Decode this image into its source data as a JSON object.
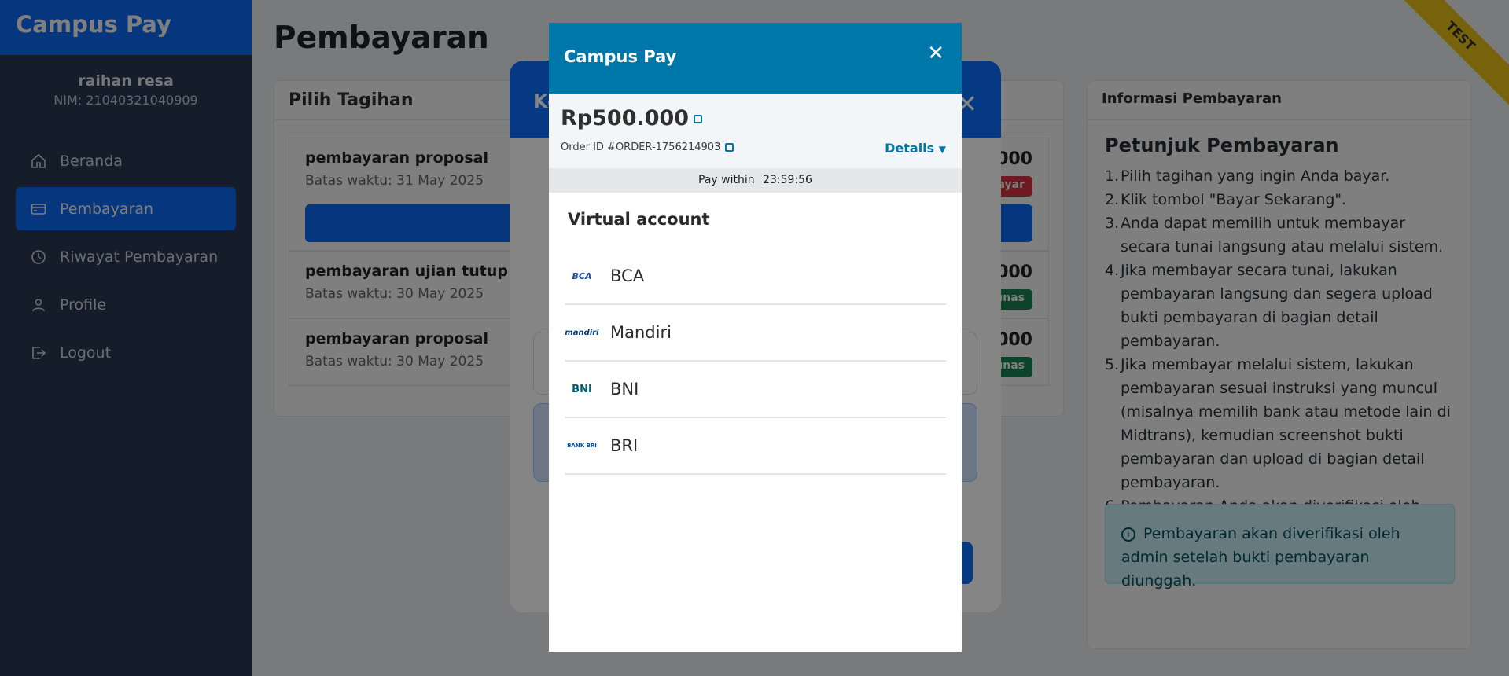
{
  "app": {
    "brand": "Campus Pay"
  },
  "user": {
    "name": "raihan resa",
    "nim": "NIM: 21040321040909"
  },
  "nav": [
    {
      "label": "Beranda",
      "icon": "home-icon",
      "active": false
    },
    {
      "label": "Pembayaran",
      "icon": "card-icon",
      "active": true
    },
    {
      "label": "Riwayat Pembayaran",
      "icon": "clock-icon",
      "active": false
    },
    {
      "label": "Profile",
      "icon": "user-icon",
      "active": false
    },
    {
      "label": "Logout",
      "icon": "logout-icon",
      "active": false
    }
  ],
  "page": {
    "title": "Pembayaran"
  },
  "bills_card": {
    "title": "Pilih Tagihan",
    "bills": [
      {
        "title": "pembayaran proposal",
        "deadline": "Batas waktu: 31 May 2025",
        "amount": "000",
        "status": "ayar",
        "status_color": "#dc3545"
      },
      {
        "title": "pembayaran ujian tutup",
        "deadline": "Batas waktu: 30 May 2025",
        "amount": "000",
        "status": "unas",
        "status_color": "#198754"
      },
      {
        "title": "pembayaran proposal",
        "deadline": "Batas waktu: 30 May 2025",
        "amount": "000",
        "status": "unas",
        "status_color": "#198754"
      }
    ]
  },
  "info_card": {
    "title": "Informasi Pembayaran",
    "guide_title": "Petunjuk Pembayaran",
    "steps": [
      "Pilih tagihan yang ingin Anda bayar.",
      "Klik tombol \"Bayar Sekarang\".",
      "Anda dapat memilih untuk membayar secara tunai langsung atau melalui sistem.",
      "Jika membayar secara tunai, lakukan pembayaran langsung dan segera upload bukti pembayaran di bagian detail pembayaran.",
      "Jika membayar melalui sistem, lakukan pembayaran sesuai instruksi yang muncul (misalnya memilih bank atau metode lain di Midtrans), kemudian screenshot bukti pembayaran dan upload di bagian detail pembayaran.",
      "Pembayaran Anda akan diverifikasi oleh admin setelah bukti pembayaran diunggah."
    ],
    "alert": "Pembayaran akan diverifikasi oleh admin setelah bukti pembayaran diunggah."
  },
  "ribbon": "TEST",
  "back_modal": {
    "title_partial": "Ko"
  },
  "snap": {
    "title": "Campus Pay",
    "amount": "Rp500.000",
    "order_id": "Order ID #ORDER-1756214903",
    "details_label": "Details",
    "pay_within_label": "Pay within",
    "countdown": "23:59:56",
    "section_title": "Virtual account",
    "banks": [
      {
        "name": "BCA",
        "logo_text": "BCA",
        "logo_color": "#1a4ba1"
      },
      {
        "name": "Mandiri",
        "logo_text": "mandiri",
        "logo_color": "#003d79"
      },
      {
        "name": "BNI",
        "logo_text": "BNI",
        "logo_color": "#005e6a"
      },
      {
        "name": "BRI",
        "logo_text": "BANK BRI",
        "logo_color": "#00529c"
      }
    ]
  }
}
